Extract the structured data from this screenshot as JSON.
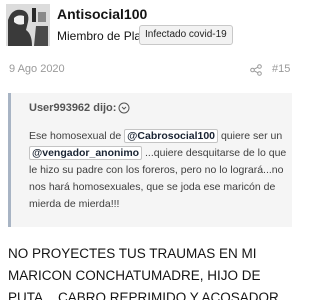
{
  "author": {
    "name": "Antisocial100",
    "title": "Miembro de Plata",
    "banner": "Infectado covid-19"
  },
  "meta": {
    "date": "9 Ago 2020",
    "post_number": "#15"
  },
  "quote": {
    "header": "User993962 dijo:",
    "text_1": "Ese homosexual de ",
    "mention_1": "@Cabrosocial100",
    "text_2": " quiere ser un ",
    "mention_2": "@vengador_anonimo",
    "text_3": " ...quiere desquitarse de lo que le hizo su padre con los foreros, pero no lo logrará...no nos hará homosexuales, que se joda ese maricón de mierda de mierda!!!"
  },
  "post": {
    "text": "NO PROYECTES TUS TRAUMAS EN MI MARICON CONCHATUMADRE, HIJO DE PUTA... CABRO REPRIMIDO Y ACOSADOR."
  },
  "icons": {
    "avatar": "avatar-image",
    "share": "share-icon",
    "quote_expand": "expand-circle-icon"
  }
}
